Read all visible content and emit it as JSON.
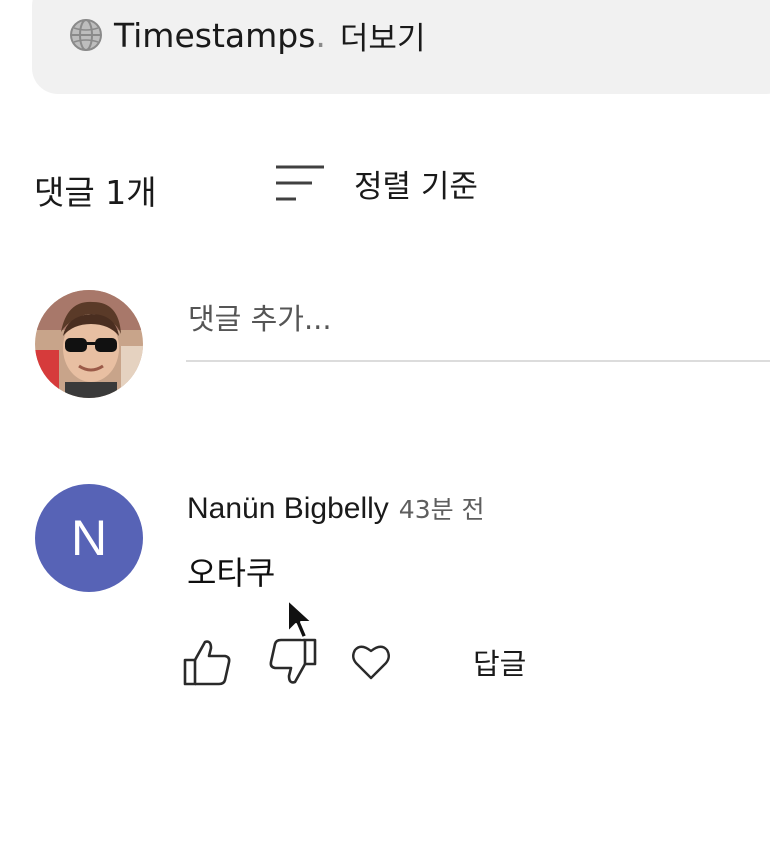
{
  "description": {
    "globe_icon": "globe-icon",
    "hashtag_text": "Timestamps",
    "ellipsis": ".",
    "more_label": "더보기"
  },
  "comments": {
    "count_label": "댓글 1개",
    "sort_label": "정렬 기준",
    "add_placeholder": "댓글 추가...",
    "items": [
      {
        "avatar_letter": "N",
        "avatar_color": "#5763b6",
        "author": "Nanün Bigbelly",
        "time": "43분 전",
        "text": "오타쿠",
        "reply_label": "답글"
      }
    ]
  }
}
